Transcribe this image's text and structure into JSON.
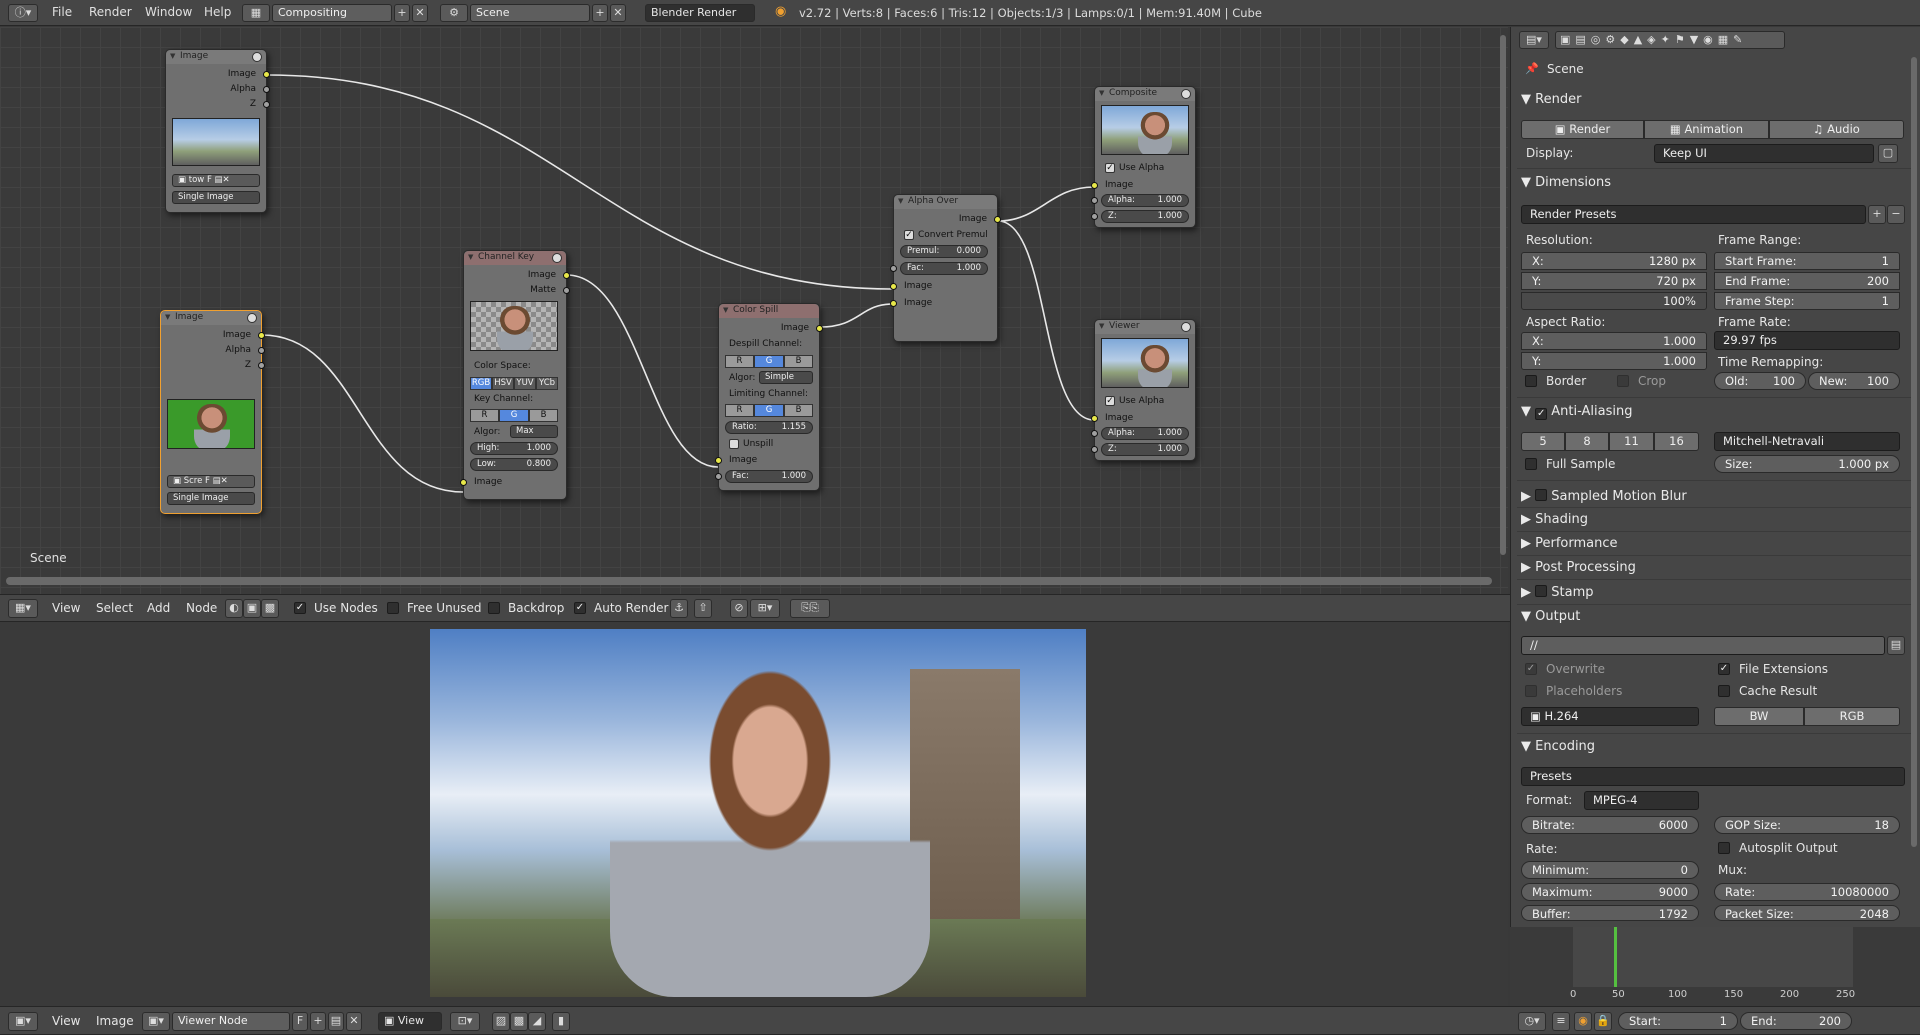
{
  "topbar": {
    "menus": [
      "File",
      "Render",
      "Window",
      "Help"
    ],
    "screen_layout": "Compositing",
    "scene": "Scene",
    "engine": "Blender Render",
    "stats": "v2.72 | Verts:8 | Faces:6 | Tris:12 | Objects:1/3 | Lamps:0/1 | Mem:91.40M | Cube"
  },
  "node_editor": {
    "scene_label": "Scene",
    "nodes": {
      "image1": {
        "title": "Image",
        "outputs": [
          "Image",
          "Alpha",
          "Z"
        ],
        "file": "tow",
        "flag": "F",
        "source": "Single Image"
      },
      "image2": {
        "title": "Image",
        "outputs": [
          "Image",
          "Alpha",
          "Z"
        ],
        "file": "Scre",
        "flag": "F",
        "source": "Single Image"
      },
      "channel_key": {
        "title": "Channel Key",
        "outputs": [
          "Image",
          "Matte"
        ],
        "color_space_label": "Color Space:",
        "color_spaces": [
          "RGB",
          "HSV",
          "YUV",
          "YCb"
        ],
        "key_channel_label": "Key Channel:",
        "channels": [
          "R",
          "G",
          "B"
        ],
        "algo_label": "Algor:",
        "algo": "Max",
        "high_label": "High:",
        "high": "1.000",
        "low_label": "Low:",
        "low": "0.800",
        "input": "Image"
      },
      "color_spill": {
        "title": "Color Spill",
        "output": "Image",
        "despill_label": "Despill Channel:",
        "channels": [
          "R",
          "G",
          "B"
        ],
        "algo_label": "Algor:",
        "algo": "Simple",
        "limit_label": "Limiting Channel:",
        "ratio_label": "Ratio:",
        "ratio": "1.155",
        "unspill": "Unspill",
        "input": "Image",
        "fac_label": "Fac:",
        "fac": "1.000"
      },
      "alpha_over": {
        "title": "Alpha Over",
        "output": "Image",
        "convert": "Convert Premul",
        "premul_label": "Premul:",
        "premul": "0.000",
        "fac_label": "Fac:",
        "fac": "1.000",
        "inputs": [
          "Image",
          "Image"
        ]
      },
      "composite": {
        "title": "Composite",
        "use_alpha": "Use Alpha",
        "input": "Image",
        "alpha_label": "Alpha:",
        "alpha": "1.000",
        "z_label": "Z:",
        "z": "1.000"
      },
      "viewer": {
        "title": "Viewer",
        "use_alpha": "Use Alpha",
        "input": "Image",
        "alpha_label": "Alpha:",
        "alpha": "1.000",
        "z_label": "Z:",
        "z": "1.000"
      }
    }
  },
  "node_header": {
    "menus": [
      "View",
      "Select",
      "Add",
      "Node"
    ],
    "use_nodes": "Use Nodes",
    "free_unused": "Free Unused",
    "backdrop": "Backdrop",
    "auto_render": "Auto Render"
  },
  "image_header": {
    "menus": [
      "View",
      "Image"
    ],
    "image_name": "Viewer Node",
    "flag": "F",
    "view": "View"
  },
  "properties": {
    "context": "Scene",
    "render": {
      "title": "Render",
      "buttons": [
        "Render",
        "Animation",
        "Audio"
      ],
      "display_label": "Display:",
      "display": "Keep UI"
    },
    "dimensions": {
      "title": "Dimensions",
      "presets": "Render Presets",
      "resolution_label": "Resolution:",
      "x_label": "X:",
      "x": "1280 px",
      "y_label": "Y:",
      "y": "720 px",
      "percent": "100%",
      "frame_range_label": "Frame Range:",
      "start_label": "Start Frame:",
      "start": "1",
      "end_label": "End Frame:",
      "end": "200",
      "step_label": "Frame Step:",
      "step": "1",
      "aspect_label": "Aspect Ratio:",
      "ax_label": "X:",
      "ax": "1.000",
      "ay_label": "Y:",
      "ay": "1.000",
      "frame_rate_label": "Frame Rate:",
      "frame_rate": "29.97 fps",
      "border": "Border",
      "crop": "Crop",
      "time_remap_label": "Time Remapping:",
      "old_label": "Old:",
      "old": "100",
      "new_label": "New:",
      "new": "100"
    },
    "anti_aliasing": {
      "title": "Anti-Aliasing",
      "samples": [
        "5",
        "8",
        "11",
        "16"
      ],
      "selected": "8",
      "filter": "Mitchell-Netravali",
      "full_sample": "Full Sample",
      "size_label": "Size:",
      "size": "1.000 px"
    },
    "collapsed": [
      "Sampled Motion Blur",
      "Shading",
      "Performance",
      "Post Processing",
      "Stamp"
    ],
    "output": {
      "title": "Output",
      "path": "//",
      "overwrite": "Overwrite",
      "file_extensions": "File Extensions",
      "placeholders": "Placeholders",
      "cache_result": "Cache Result",
      "format": "H.264",
      "color_modes": [
        "BW",
        "RGB"
      ]
    },
    "encoding": {
      "title": "Encoding",
      "presets": "Presets",
      "format_label": "Format:",
      "format": "MPEG-4",
      "bitrate_label": "Bitrate:",
      "bitrate": "6000",
      "gop_label": "GOP Size:",
      "gop": "18",
      "rate_label": "Rate:",
      "autosplit": "Autosplit Output",
      "min_label": "Minimum:",
      "min": "0",
      "mux_label": "Mux:",
      "max_label": "Maximum:",
      "max": "9000",
      "mux_rate_label": "Rate:",
      "mux_rate": "10080000",
      "buffer_label": "Buffer:",
      "buffer": "1792",
      "packet_label": "Packet Size:",
      "packet": "2048"
    }
  },
  "timeline": {
    "ticks": [
      "0",
      "50",
      "100",
      "150",
      "200",
      "250"
    ],
    "start_label": "Start:",
    "start": "1",
    "end_label": "End:",
    "end": "200"
  },
  "colors": {
    "accent": "#5588dd",
    "socket": "#e8e84a",
    "background": "#393939"
  }
}
